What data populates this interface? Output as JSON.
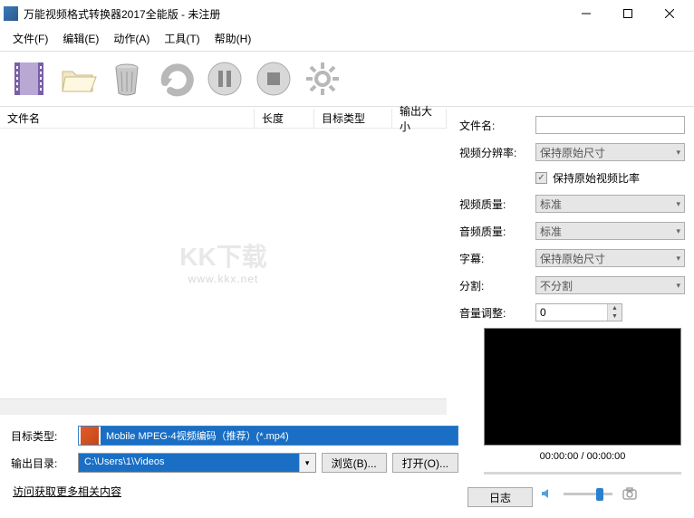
{
  "window": {
    "title": "万能视频格式转换器2017全能版 - 未注册"
  },
  "menu": {
    "file": "文件(F)",
    "edit": "编辑(E)",
    "action": "动作(A)",
    "tool": "工具(T)",
    "help": "帮助(H)"
  },
  "list_columns": {
    "name": "文件名",
    "length": "长度",
    "target_type": "目标类型",
    "output_size": "输出大小"
  },
  "watermark": {
    "main": "KK下载",
    "sub": "www.kkx.net"
  },
  "side_form": {
    "filename_label": "文件名:",
    "filename_value": "",
    "resolution_label": "视频分辨率:",
    "resolution_value": "保持原始尺寸",
    "keep_ratio_label": "保持原始视频比率",
    "keep_ratio_checked": true,
    "video_quality_label": "视频质量:",
    "video_quality_value": "标准",
    "audio_quality_label": "音频质量:",
    "audio_quality_value": "标准",
    "subtitle_label": "字幕:",
    "subtitle_value": "保持原始尺寸",
    "split_label": "分割:",
    "split_value": "不分割",
    "volume_label": "音量调整:",
    "volume_value": "0"
  },
  "preview": {
    "time_current": "00:00:00",
    "time_total": "00:00:00"
  },
  "bottom": {
    "target_label": "目标类型:",
    "target_value": "Mobile MPEG-4视频编码（推荐）(*.mp4)",
    "output_label": "输出目录:",
    "output_value": "C:\\Users\\1\\Videos",
    "browse_btn": "浏览(B)...",
    "open_btn": "打开(O)...",
    "link": "访问获取更多相关内容",
    "log_btn": "日志"
  }
}
